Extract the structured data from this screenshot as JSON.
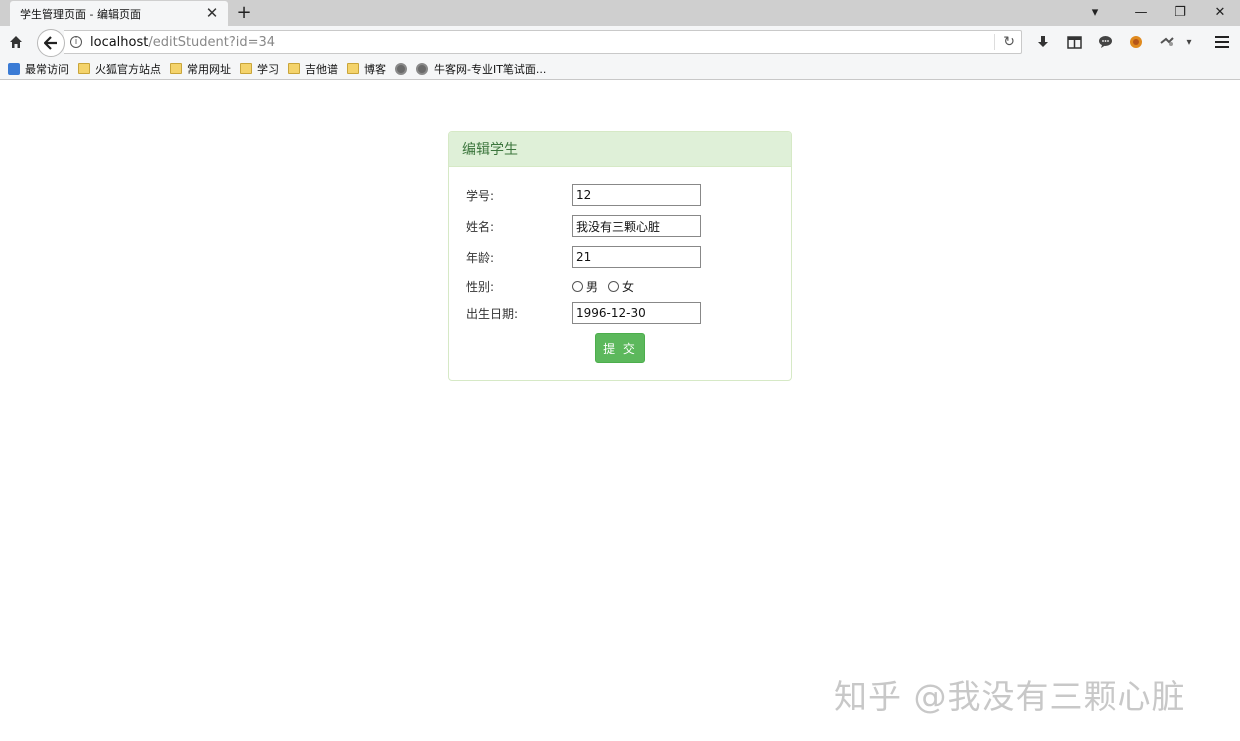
{
  "browser": {
    "tab_title": "学生管理页面 - 编辑页面",
    "tab_close": "✕",
    "new_tab": "+",
    "window_controls": {
      "dropdown": "▾",
      "minimize": "—",
      "restore": "❐",
      "close": "✕"
    },
    "url_host": "localhost",
    "url_path": "/editStudent?id=34",
    "bookmarks": [
      {
        "label": "最常访问",
        "icon": "star-icon"
      },
      {
        "label": "火狐官方站点",
        "icon": "folder-icon"
      },
      {
        "label": "常用网址",
        "icon": "folder-icon"
      },
      {
        "label": "学习",
        "icon": "folder-icon"
      },
      {
        "label": "吉他谱",
        "icon": "folder-icon"
      },
      {
        "label": "博客",
        "icon": "folder-icon"
      },
      {
        "label": "",
        "icon": "globe-icon"
      },
      {
        "label": "牛客网-专业IT笔试面...",
        "icon": "globe-icon"
      }
    ]
  },
  "form": {
    "title": "编辑学生",
    "fields": {
      "id": {
        "label": "学号:",
        "value": "12"
      },
      "name": {
        "label": "姓名:",
        "value": "我没有三颗心脏"
      },
      "age": {
        "label": "年龄:",
        "value": "21"
      },
      "gender": {
        "label": "性别:",
        "options": [
          "男",
          "女"
        ]
      },
      "birthday": {
        "label": "出生日期:",
        "value": "1996-12-30"
      }
    },
    "submit_label": "提 交"
  },
  "watermark": "知乎 @我没有三颗心脏",
  "colors": {
    "panel_header_bg": "#dff0d8",
    "panel_title": "#3c763d",
    "submit_bg": "#5cb85c"
  }
}
